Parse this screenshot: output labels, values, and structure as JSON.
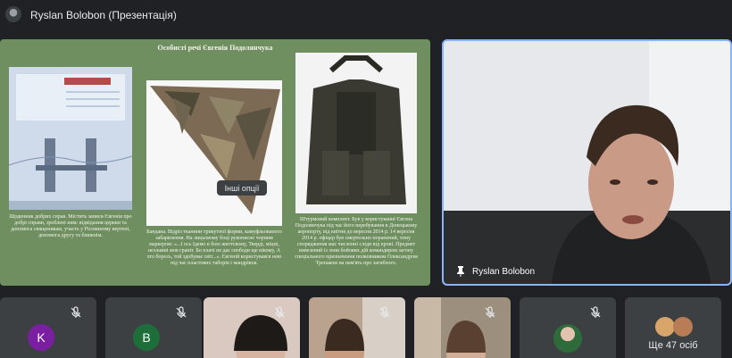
{
  "window": {
    "title": "Ryslan Bolobon (Презентація)"
  },
  "slide": {
    "title": "Особисті речі Євгенія Подолянчука",
    "captions": [
      "Щоденник добрих справ. Містить записи Євгенія про добрі справи, зроблені ним: відвідання церкви та допомога священикам, участь у Рісовиному вертепі, допомога другу та ближнім.",
      "Бандана. Відріз тканини трикутної форми, камуфльованого забарвлення. На лицьовому боці рукописне чорним маркером: «...І ось Ідемо в бою життєвому, Тверді, міцні, незламні мов граніт. Бо плачі не дає свободи ще нікому, А хто боресь, той здобуває світ...». Євгеній користувався нею під час пластових таборів і мандрівок.",
      "Штурмовий комплект. Був у користуванні Євгена Подолянчука під час його перебування в Донецькому аеропорту, від квітня до вересня 2014 р. 14 вересня 2014 р. офіцер був смертельно поранений, тому споряджения має численні сліди від крові. Предмет вивезений із зони бойових дій командиром загону спеціального призначення полковником Олександром Трепаком на пам'ять про загиблого."
    ]
  },
  "tooltip": "Інші опції",
  "self_view": {
    "name": "Ryslan Bolobon"
  },
  "participants": [
    {
      "letter": "K",
      "color": "#7b1fa2"
    },
    {
      "letter": "B",
      "color": "#1e6e3a"
    }
  ],
  "more": {
    "label": "Ще 47 осіб"
  }
}
